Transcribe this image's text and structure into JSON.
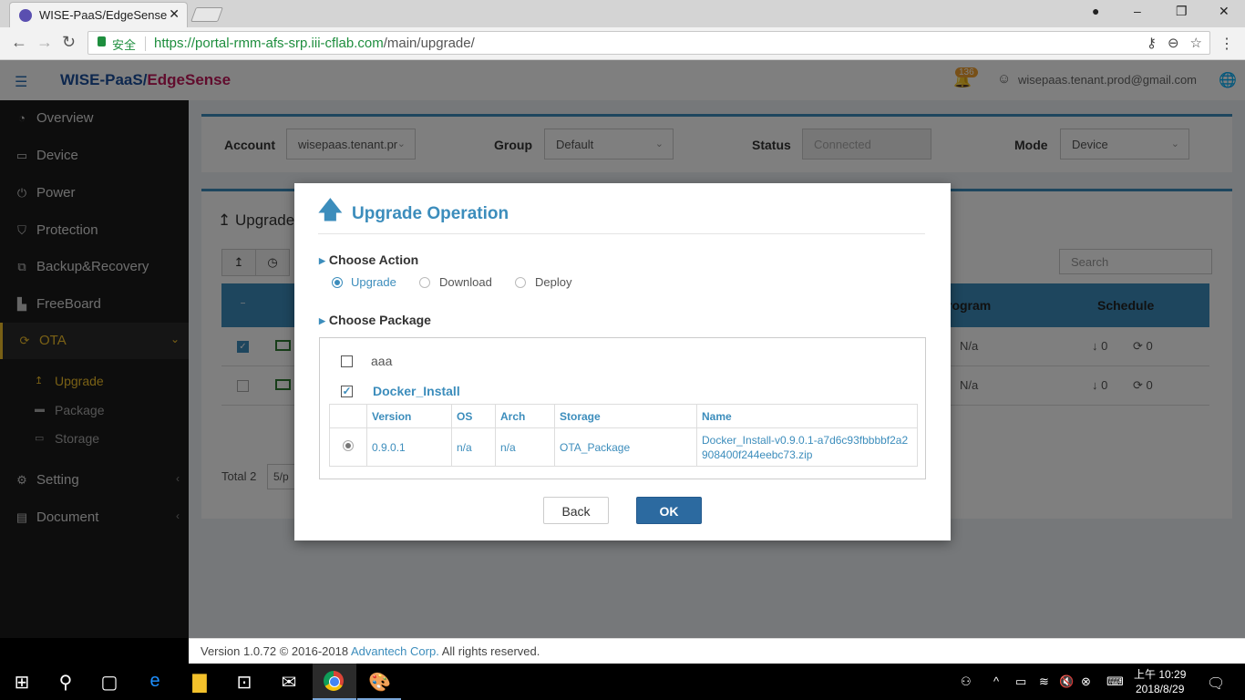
{
  "browser": {
    "tab_title": "WISE-PaaS/EdgeSense",
    "tab_close": "✕",
    "secure_label": "安全",
    "url_host": "https://portal-rmm-afs-srp.iii-cflab.com",
    "url_path": "/main/upgrade/",
    "window_controls": [
      "–",
      "❐",
      "✕"
    ]
  },
  "header": {
    "brand_part1": "WISE-PaaS/",
    "brand_part2": "EdgeSense",
    "notification_count": "136",
    "user_email": "wisepaas.tenant.prod@gmail.com"
  },
  "sidebar": {
    "items": [
      {
        "label": "Overview",
        "icon": "dashboard-icon"
      },
      {
        "label": "Device",
        "icon": "monitor-icon"
      },
      {
        "label": "Power",
        "icon": "power-icon"
      },
      {
        "label": "Protection",
        "icon": "shield-icon"
      },
      {
        "label": "Backup&Recovery",
        "icon": "backup-icon"
      },
      {
        "label": "FreeBoard",
        "icon": "chart-icon"
      },
      {
        "label": "OTA",
        "icon": "refresh-icon"
      },
      {
        "label": "Setting",
        "icon": "gears-icon"
      },
      {
        "label": "Document",
        "icon": "book-icon"
      }
    ],
    "ota_subitems": [
      {
        "label": "Upgrade",
        "icon": "upload-icon"
      },
      {
        "label": "Package",
        "icon": "drive-icon"
      },
      {
        "label": "Storage",
        "icon": "storage-icon"
      }
    ]
  },
  "filters": {
    "account_label": "Account",
    "account_value": "wisepaas.tenant.pr",
    "group_label": "Group",
    "group_value": "Default",
    "status_label": "Status",
    "status_value": "Connected",
    "mode_label": "Mode",
    "mode_value": "Device"
  },
  "upgrade_panel": {
    "title": "Upgrade",
    "search_placeholder": "Search",
    "col_program": "rogram",
    "col_schedule": "Schedule",
    "rows": [
      {
        "checked": true,
        "program": "N/a",
        "download": "0",
        "sync": "0"
      },
      {
        "checked": false,
        "program": "N/a",
        "download": "0",
        "sync": "0"
      }
    ],
    "total": "Total 2",
    "page_size": "5/p"
  },
  "modal": {
    "title": "Upgrade Operation",
    "choose_action": "Choose Action",
    "actions": [
      "Upgrade",
      "Download",
      "Deploy"
    ],
    "selected_action": "Upgrade",
    "choose_package": "Choose Package",
    "packages": [
      {
        "name": "aaa",
        "checked": false
      },
      {
        "name": "Docker_Install",
        "checked": true
      }
    ],
    "table_headers": [
      "Version",
      "OS",
      "Arch",
      "Storage",
      "Name"
    ],
    "table_rows": [
      {
        "version": "0.9.0.1",
        "os": "n/a",
        "arch": "n/a",
        "storage": "OTA_Package",
        "name": "Docker_Install-v0.9.0.1-a7d6c93fbbbbf2a2908400f244eebc73.zip"
      }
    ],
    "back_label": "Back",
    "ok_label": "OK"
  },
  "footer": {
    "prefix": "Version 1.0.72 © 2016-2018 ",
    "company": "Advantech Corp.",
    "suffix": " All rights reserved."
  },
  "taskbar": {
    "time": "上午 10:29",
    "date": "2018/8/29"
  },
  "colors": {
    "accent": "#3c8dbc",
    "sidebar_active": "#f3c12b",
    "ok_button": "#2c6aa0"
  }
}
